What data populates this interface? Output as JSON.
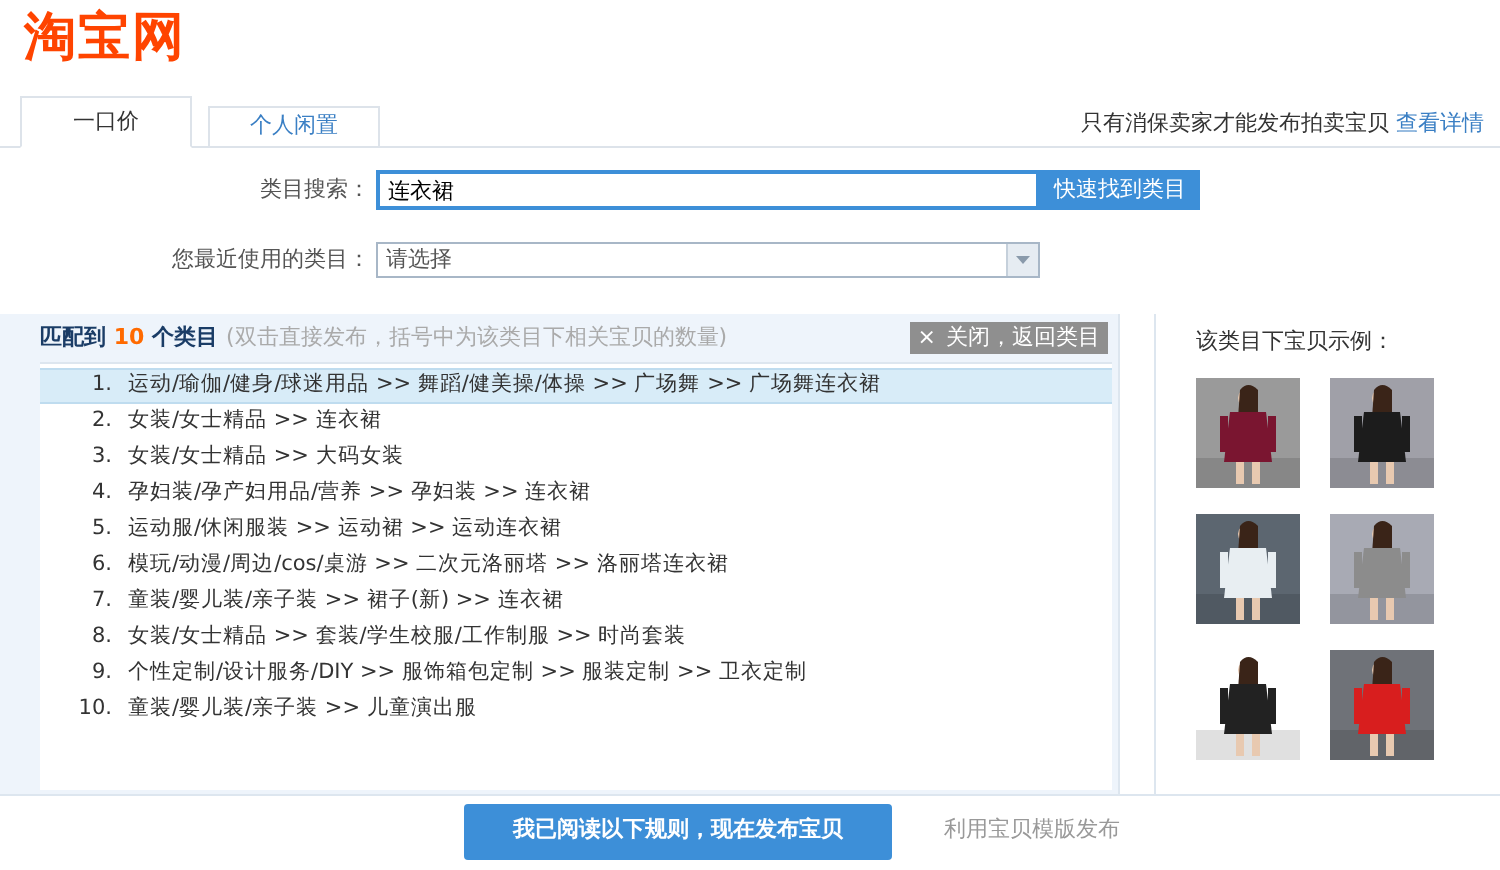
{
  "logo": "淘宝网",
  "tabs": [
    {
      "label": "一口价",
      "selected": true
    },
    {
      "label": "个人闲置",
      "selected": false
    }
  ],
  "notice": {
    "text": "只有消保卖家才能发布拍卖宝贝",
    "link": "查看详情"
  },
  "search": {
    "label": "类目搜索：",
    "value": "连衣裙",
    "button": "快速找到类目"
  },
  "recent": {
    "label": "您最近使用的类目：",
    "value": "请选择"
  },
  "results": {
    "prefix": "匹配到",
    "count": "10",
    "suffix": "个类目",
    "hint": "(双击直接发布，括号中为该类目下相关宝贝的数量)",
    "close_icon": "×",
    "close": "关闭，返回类目",
    "items": [
      {
        "number": "1.",
        "path": "运动/瑜伽/健身/球迷用品 >> 舞蹈/健美操/体操 >> 广场舞 >> 广场舞连衣裙",
        "selected": true
      },
      {
        "number": "2.",
        "path": "女装/女士精品 >> 连衣裙",
        "selected": false
      },
      {
        "number": "3.",
        "path": "女装/女士精品 >> 大码女装",
        "selected": false
      },
      {
        "number": "4.",
        "path": "孕妇装/孕产妇用品/营养 >> 孕妇装 >> 连衣裙",
        "selected": false
      },
      {
        "number": "5.",
        "path": "运动服/休闲服装 >> 运动裙 >> 运动连衣裙",
        "selected": false
      },
      {
        "number": "6.",
        "path": "模玩/动漫/周边/cos/桌游 >> 二次元洛丽塔 >> 洛丽塔连衣裙",
        "selected": false
      },
      {
        "number": "7.",
        "path": "童装/婴儿装/亲子装 >> 裙子(新) >> 连衣裙",
        "selected": false
      },
      {
        "number": "8.",
        "path": "女装/女士精品 >> 套装/学生校服/工作制服 >> 时尚套装",
        "selected": false
      },
      {
        "number": "9.",
        "path": "个性定制/设计服务/DIY >> 服饰箱包定制 >> 服装定制 >> 卫衣定制",
        "selected": false
      },
      {
        "number": "10.",
        "path": "童装/婴儿装/亲子装 >> 儿童演出服",
        "selected": false
      }
    ]
  },
  "examples": {
    "title": "该类目下宝贝示例："
  },
  "footer": {
    "publish": "我已阅读以下规则，现在发布宝贝",
    "template": "利用宝贝模版发布"
  }
}
